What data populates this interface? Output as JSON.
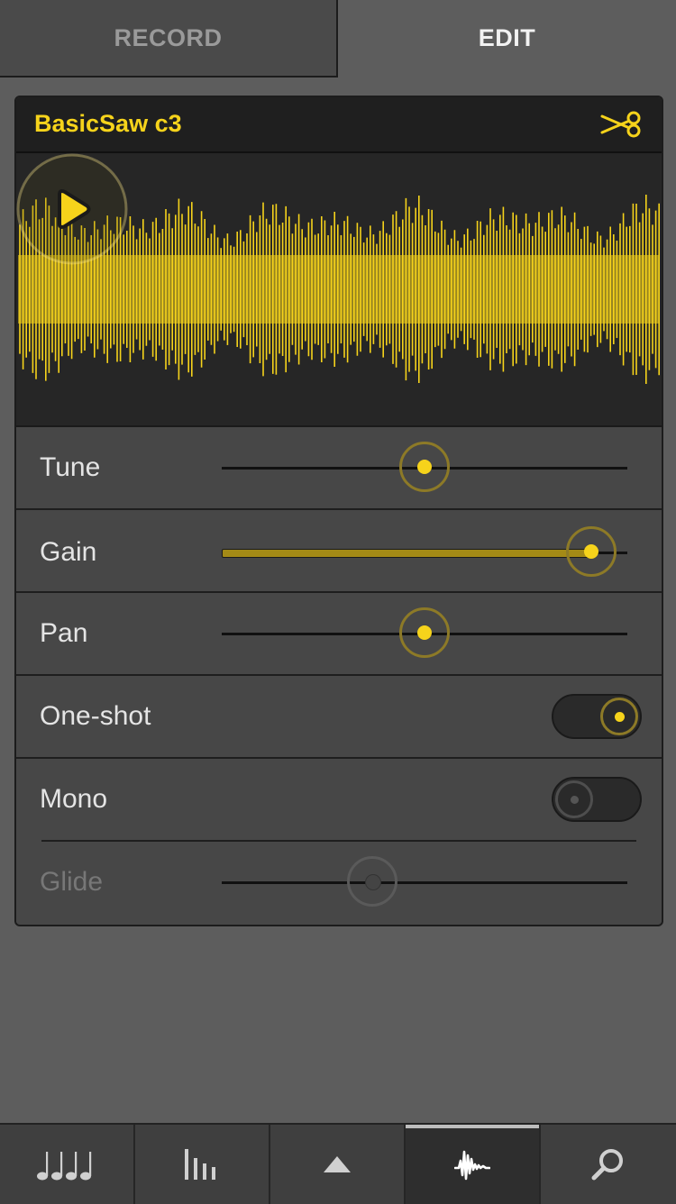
{
  "tabs": [
    {
      "label": "RECORD",
      "active": false
    },
    {
      "label": "EDIT",
      "active": true
    }
  ],
  "sample": {
    "name": "BasicSaw c3",
    "action_icon": "scissors-icon"
  },
  "waveform": {
    "color": "#f6d31b",
    "play_icon": "play-icon"
  },
  "controls": {
    "tune": {
      "label": "Tune",
      "value": 0.5
    },
    "gain": {
      "label": "Gain",
      "value": 0.91
    },
    "pan": {
      "label": "Pan",
      "value": 0.5
    },
    "one_shot": {
      "label": "One-shot",
      "on": true
    },
    "mono": {
      "label": "Mono",
      "on": false
    },
    "glide": {
      "label": "Glide",
      "value": 0.37,
      "enabled": false
    }
  },
  "colors": {
    "accent": "#f6d31b",
    "background": "#5d5d5d",
    "panel": "#474747"
  },
  "bottom_nav": [
    {
      "icon": "music-notes-icon",
      "active": false
    },
    {
      "icon": "mixer-bars-icon",
      "active": false
    },
    {
      "icon": "up-arrow-icon",
      "active": false
    },
    {
      "icon": "waveform-icon",
      "active": true
    },
    {
      "icon": "search-icon",
      "active": false
    }
  ]
}
